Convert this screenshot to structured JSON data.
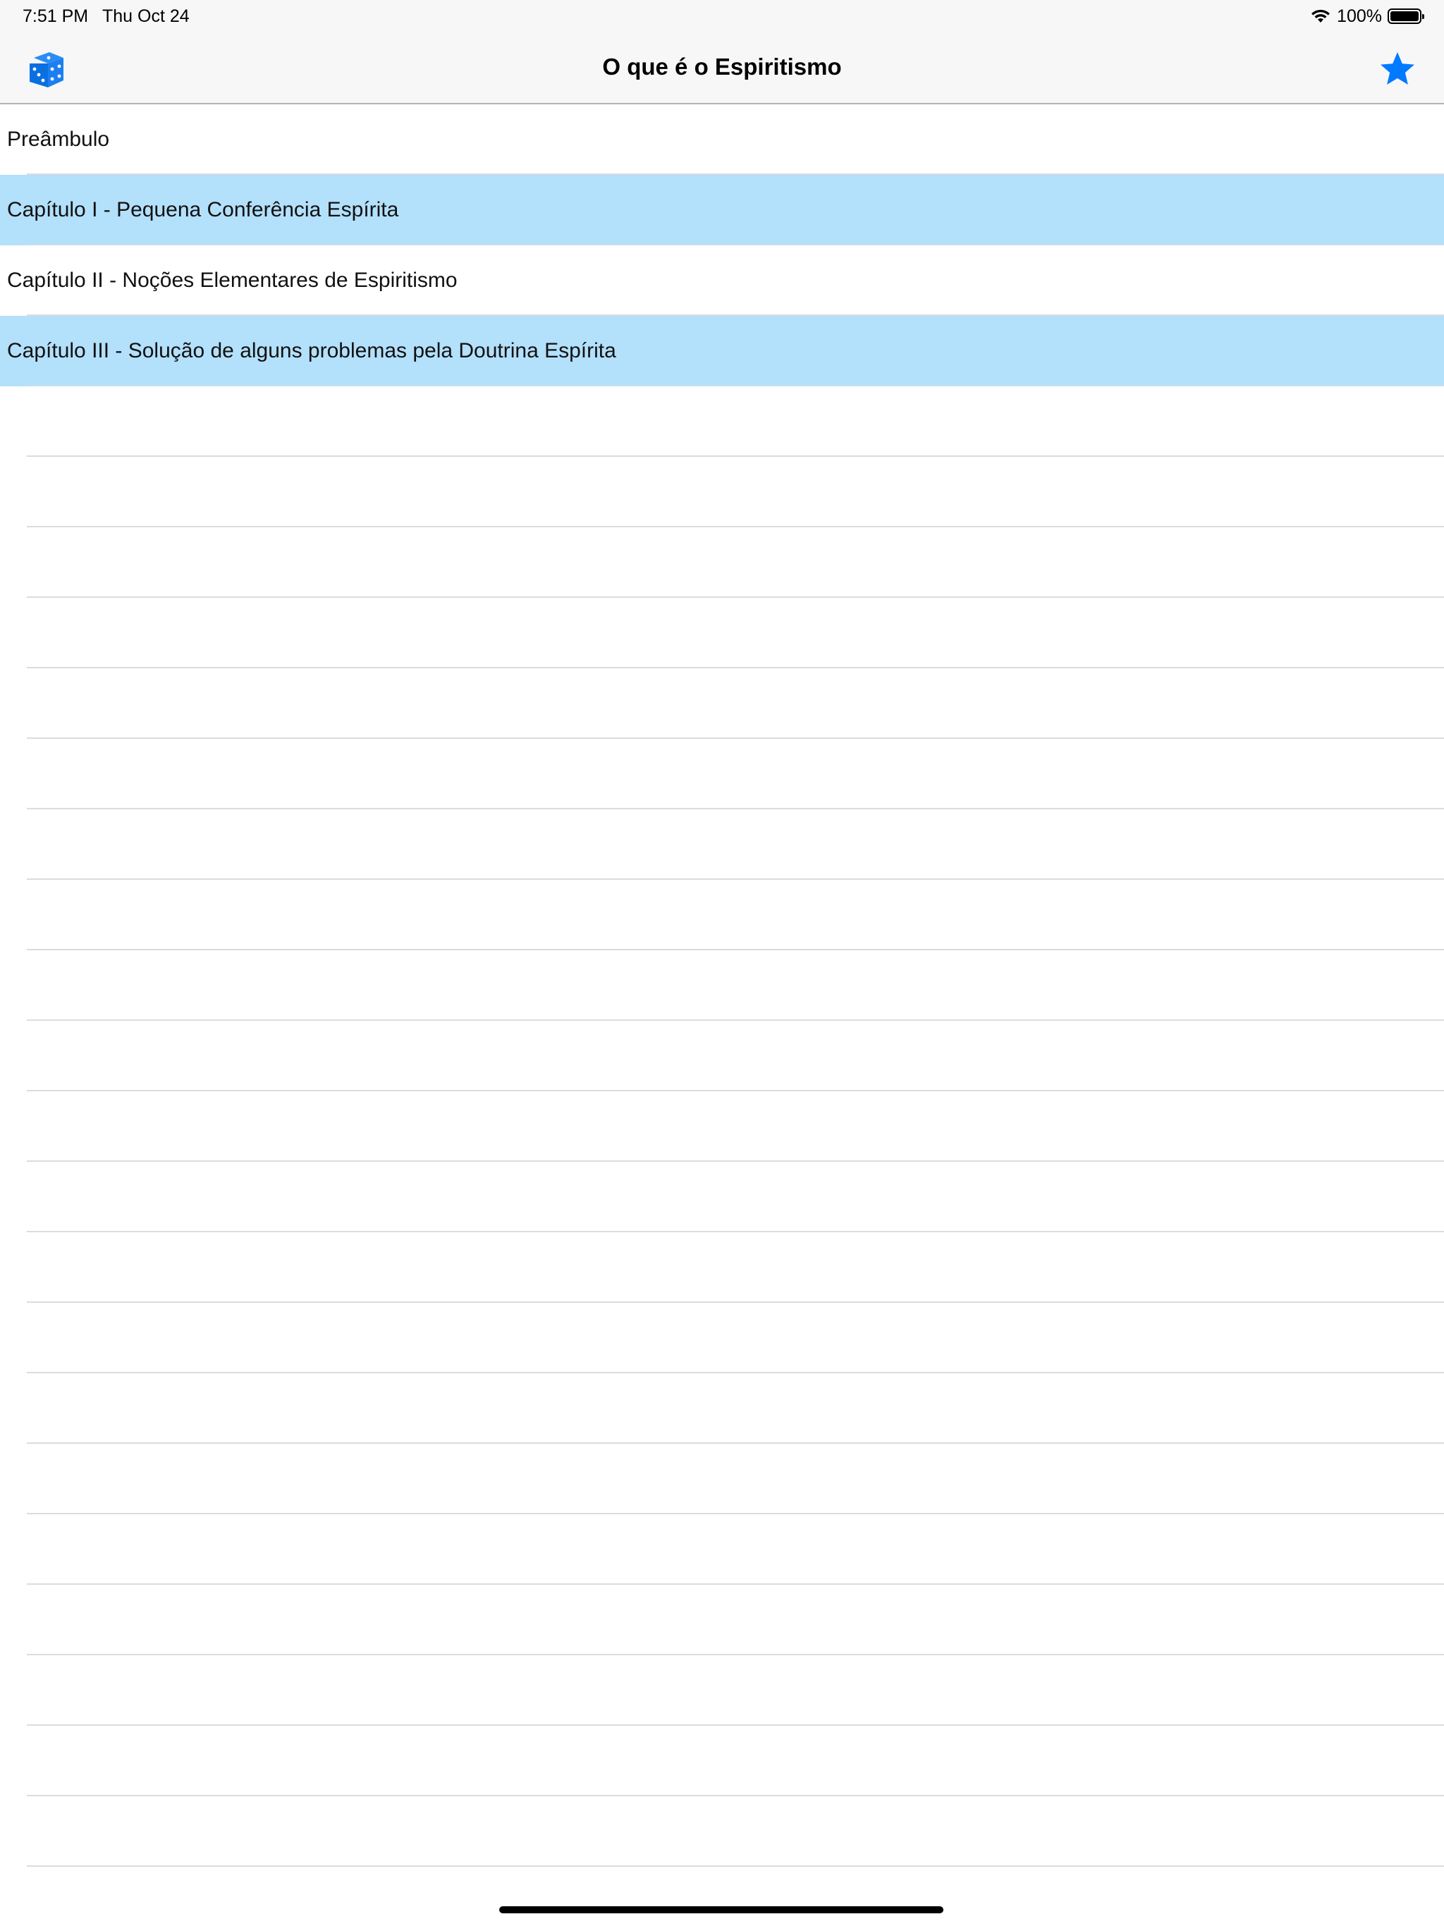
{
  "status_bar": {
    "time": "7:51 PM",
    "date": "Thu Oct 24",
    "battery_percent": "100%",
    "battery_level": 1.0,
    "icons": [
      "wifi-icon",
      "battery-icon"
    ]
  },
  "nav": {
    "title": "O que é o Espiritismo",
    "left_icon": "dice-icon",
    "right_icon": "star-icon",
    "accent_color": "#007aff"
  },
  "colors": {
    "highlight_row": "#b3e0fb",
    "separator": "#dcdcdc",
    "nav_background": "#f7f7f7"
  },
  "chapters": [
    {
      "label": "Preâmbulo",
      "highlighted": false
    },
    {
      "label": "Capítulo I - Pequena Conferência Espírita",
      "highlighted": true
    },
    {
      "label": "Capítulo II - Noções Elementares de Espiritismo",
      "highlighted": false
    },
    {
      "label": "Capítulo III - Solução de alguns problemas pela Doutrina Espírita",
      "highlighted": true
    }
  ]
}
